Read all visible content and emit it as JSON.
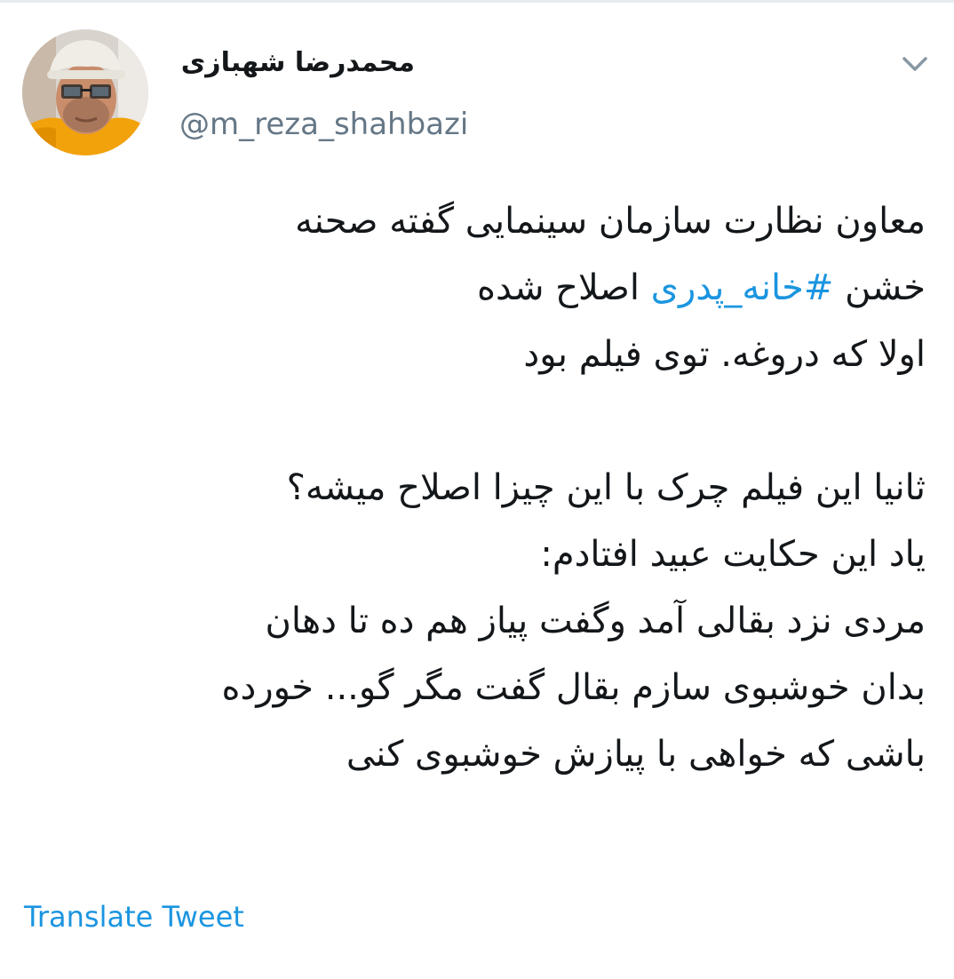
{
  "author": {
    "display_name": "محمدرضا شهبازی",
    "handle": "@m_reza_shahbazi",
    "avatar": "profile-photo"
  },
  "menu": {
    "icon": "chevron-down-icon"
  },
  "tweet": {
    "line1": "معاون نظارت سازمان سینمایی گفته صحنه",
    "line2_before": "خشن ",
    "line2_hashtag": "#خانه_پدری",
    "line2_after": " اصلاح شده",
    "line3": "اولا که دروغه. توی فیلم بود",
    "line4": "ثانیا این فیلم چرک با این چیزا اصلاح میشه؟",
    "line5": "یاد این حکایت عبید افتادم:",
    "line6": "مردی نزد بقالی آمد وگفت پیاز هم ده تا دهان",
    "line7": "بدان خوشبوی سازم بقال گفت مگر گو... خورده",
    "line8": "باشی که خواهی با پیازش خوشبوی کنی"
  },
  "actions": {
    "translate_label": "Translate Tweet"
  },
  "colors": {
    "text": "#14171a",
    "muted": "#657786",
    "link": "#1b95e0"
  }
}
